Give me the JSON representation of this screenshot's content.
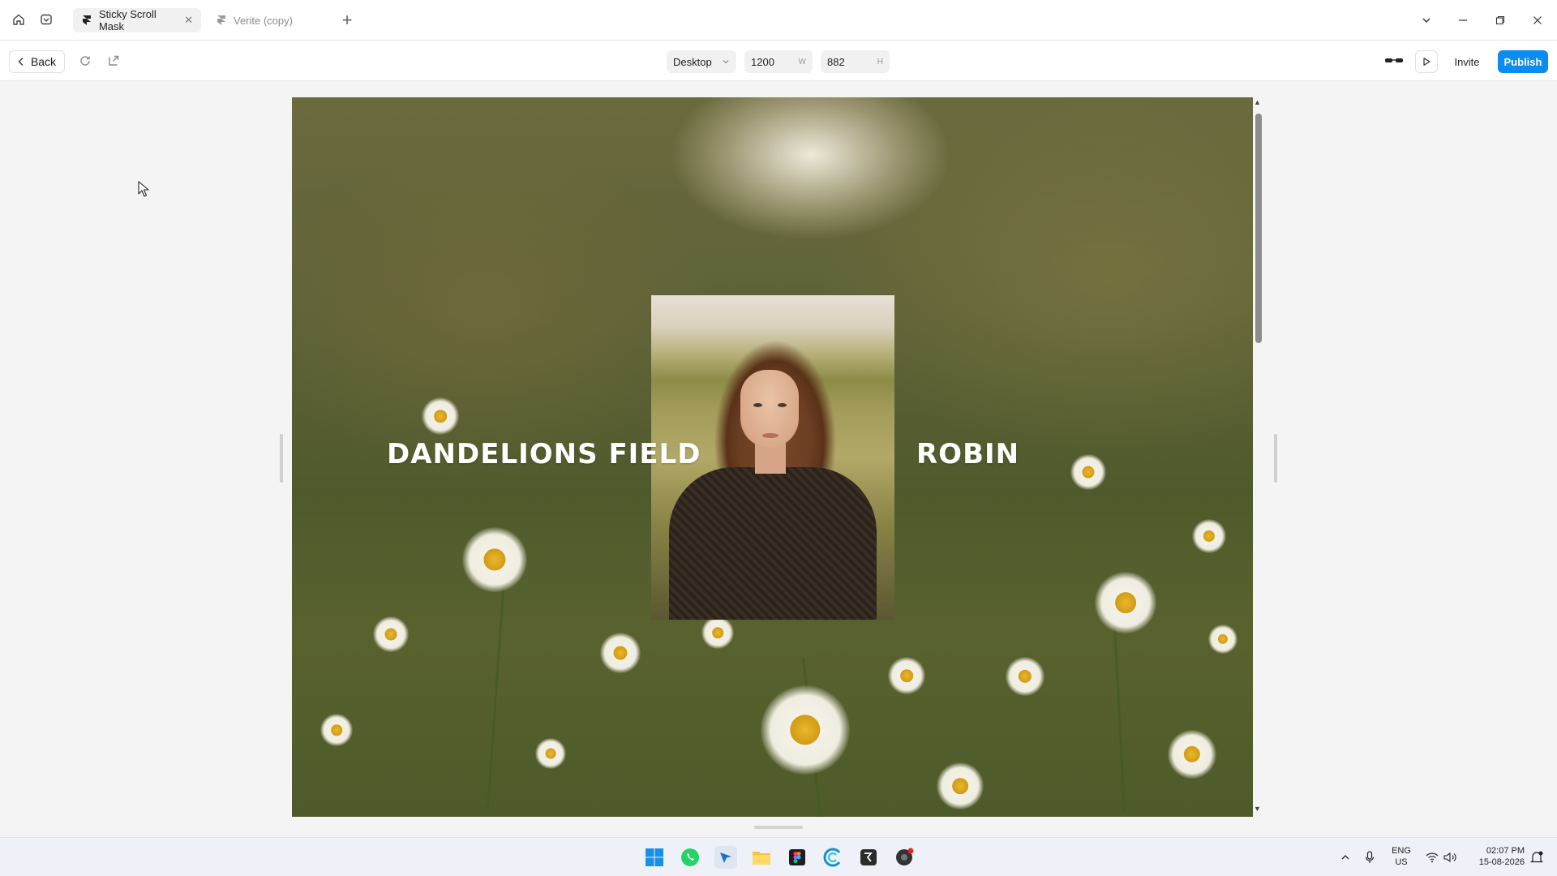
{
  "titlebar": {
    "tabs": [
      {
        "label": "Sticky Scroll Mask",
        "active": true
      },
      {
        "label": "Verite (copy)",
        "active": false
      }
    ]
  },
  "toolbar": {
    "back_label": "Back",
    "device": "Desktop",
    "width_value": "1200",
    "width_suffix": "W",
    "height_value": "882",
    "height_suffix": "H",
    "invite_label": "Invite",
    "publish_label": "Publish"
  },
  "preview": {
    "left_text": "DANDELIONS FIELD",
    "right_text": "ROBIN"
  },
  "taskbar": {
    "lang_top": "ENG",
    "lang_bottom": "US",
    "time": "02:07 PM",
    "date": "15-08-2026"
  },
  "colors": {
    "accent": "#0a8cf0",
    "canvas_bg": "#f4f4f4"
  }
}
